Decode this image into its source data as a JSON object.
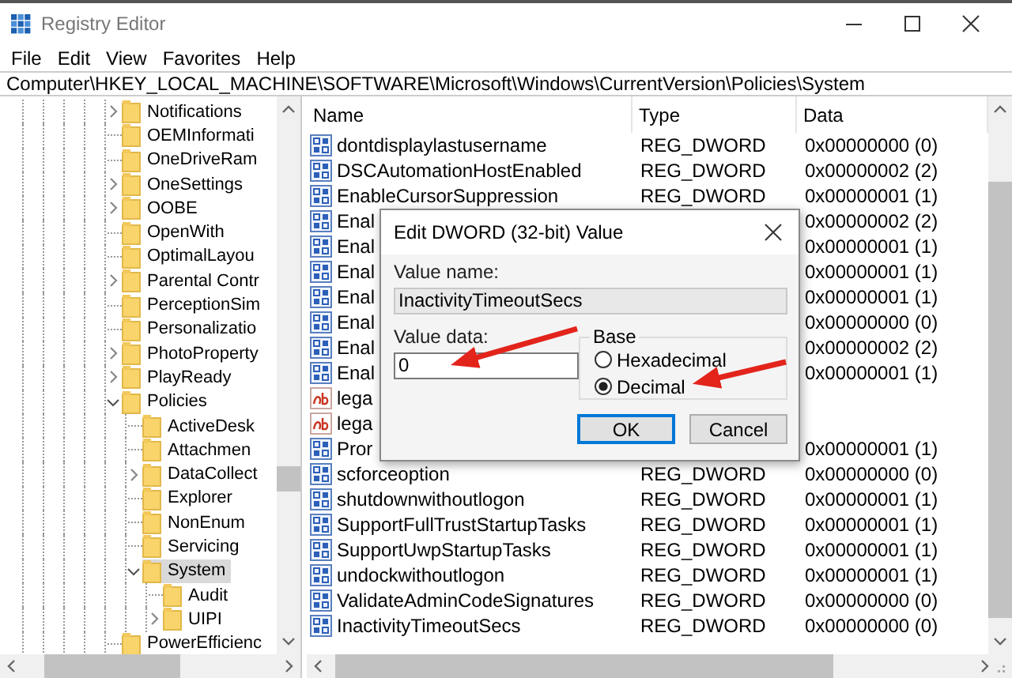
{
  "window": {
    "title": "Registry Editor"
  },
  "menu": [
    "File",
    "Edit",
    "View",
    "Favorites",
    "Help"
  ],
  "address": "Computer\\HKEY_LOCAL_MACHINE\\SOFTWARE\\Microsoft\\Windows\\CurrentVersion\\Policies\\System",
  "tree": [
    {
      "label": "Notifications",
      "expandable": true,
      "expanded": false,
      "selected": false
    },
    {
      "label": "OEMInformati",
      "expandable": false,
      "expanded": false,
      "selected": false
    },
    {
      "label": "OneDriveRam",
      "expandable": false,
      "expanded": false,
      "selected": false
    },
    {
      "label": "OneSettings",
      "expandable": true,
      "expanded": false,
      "selected": false
    },
    {
      "label": "OOBE",
      "expandable": true,
      "expanded": false,
      "selected": false
    },
    {
      "label": "OpenWith",
      "expandable": false,
      "expanded": false,
      "selected": false
    },
    {
      "label": "OptimalLayou",
      "expandable": false,
      "expanded": false,
      "selected": false
    },
    {
      "label": "Parental Contr",
      "expandable": true,
      "expanded": false,
      "selected": false
    },
    {
      "label": "PerceptionSim",
      "expandable": false,
      "expanded": false,
      "selected": false
    },
    {
      "label": "Personalizatio",
      "expandable": false,
      "expanded": false,
      "selected": false
    },
    {
      "label": "PhotoProperty",
      "expandable": true,
      "expanded": false,
      "selected": false
    },
    {
      "label": "PlayReady",
      "expandable": true,
      "expanded": false,
      "selected": false
    },
    {
      "label": "Policies",
      "expandable": true,
      "expanded": true,
      "selected": false,
      "children": [
        {
          "label": "ActiveDesk",
          "expandable": false,
          "expanded": false,
          "selected": false
        },
        {
          "label": "Attachmen",
          "expandable": false,
          "expanded": false,
          "selected": false
        },
        {
          "label": "DataCollect",
          "expandable": true,
          "expanded": false,
          "selected": false
        },
        {
          "label": "Explorer",
          "expandable": false,
          "expanded": false,
          "selected": false
        },
        {
          "label": "NonEnum",
          "expandable": false,
          "expanded": false,
          "selected": false
        },
        {
          "label": "Servicing",
          "expandable": false,
          "expanded": false,
          "selected": false
        },
        {
          "label": "System",
          "expandable": true,
          "expanded": true,
          "selected": true,
          "children": [
            {
              "label": "Audit",
              "expandable": false,
              "expanded": false,
              "selected": false
            },
            {
              "label": "UIPI",
              "expandable": true,
              "expanded": false,
              "selected": false
            }
          ]
        }
      ]
    },
    {
      "label": "PowerEfficienc",
      "expandable": false,
      "expanded": false,
      "selected": false
    }
  ],
  "values": {
    "columns": [
      "Name",
      "Type",
      "Data"
    ],
    "rows": [
      {
        "kind": "dword",
        "name": "dontdisplaylastusername",
        "type": "REG_DWORD",
        "data": "0x00000000 (0)"
      },
      {
        "kind": "dword",
        "name": "DSCAutomationHostEnabled",
        "type": "REG_DWORD",
        "data": "0x00000002 (2)"
      },
      {
        "kind": "dword",
        "name": "EnableCursorSuppression",
        "type": "REG_DWORD",
        "data": "0x00000001 (1)"
      },
      {
        "kind": "dword",
        "name": "Enal",
        "data": "0x00000002 (2)"
      },
      {
        "kind": "dword",
        "name": "Enal",
        "data": "0x00000001 (1)"
      },
      {
        "kind": "dword",
        "name": "Enal",
        "data": "0x00000001 (1)"
      },
      {
        "kind": "dword",
        "name": "Enal",
        "data": "0x00000001 (1)"
      },
      {
        "kind": "dword",
        "name": "Enal",
        "data": "0x00000000 (0)"
      },
      {
        "kind": "dword",
        "name": "Enal",
        "data": "0x00000002 (2)"
      },
      {
        "kind": "dword",
        "name": "Enal",
        "data": "0x00000001 (1)"
      },
      {
        "kind": "string",
        "name": "lega"
      },
      {
        "kind": "string",
        "name": "lega"
      },
      {
        "kind": "dword",
        "name": "Pror",
        "data": "0x00000001 (1)"
      },
      {
        "kind": "dword",
        "name": "scforceoption",
        "type": "REG_DWORD",
        "data": "0x00000000 (0)"
      },
      {
        "kind": "dword",
        "name": "shutdownwithoutlogon",
        "type": "REG_DWORD",
        "data": "0x00000001 (1)"
      },
      {
        "kind": "dword",
        "name": "SupportFullTrustStartupTasks",
        "type": "REG_DWORD",
        "data": "0x00000001 (1)"
      },
      {
        "kind": "dword",
        "name": "SupportUwpStartupTasks",
        "type": "REG_DWORD",
        "data": "0x00000001 (1)"
      },
      {
        "kind": "dword",
        "name": "undockwithoutlogon",
        "type": "REG_DWORD",
        "data": "0x00000001 (1)"
      },
      {
        "kind": "dword",
        "name": "ValidateAdminCodeSignatures",
        "type": "REG_DWORD",
        "data": "0x00000000 (0)"
      },
      {
        "kind": "dword",
        "name": "InactivityTimeoutSecs",
        "type": "REG_DWORD",
        "data": "0x00000000 (0)"
      }
    ]
  },
  "dialog": {
    "title": "Edit DWORD (32-bit) Value",
    "value_name_label": "Value name:",
    "value_name": "InactivityTimeoutSecs",
    "value_data_label": "Value data:",
    "value_data": "0",
    "base_label": "Base",
    "base_options": [
      {
        "label": "Hexadecimal",
        "selected": false
      },
      {
        "label": "Decimal",
        "selected": true
      }
    ],
    "buttons": [
      {
        "label": "OK",
        "default": true
      },
      {
        "label": "Cancel",
        "default": false
      }
    ]
  }
}
